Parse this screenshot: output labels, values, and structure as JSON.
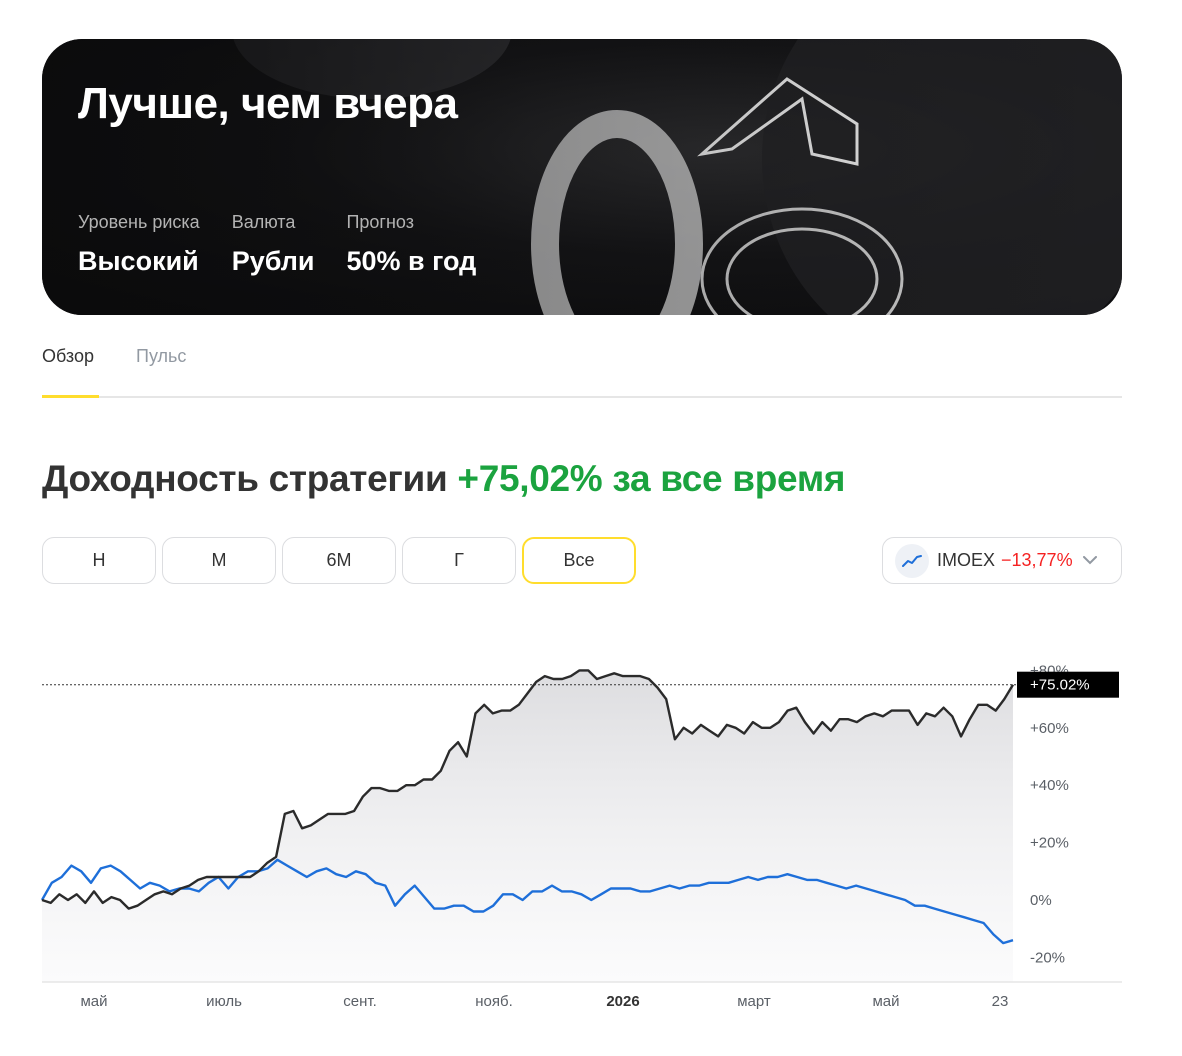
{
  "hero": {
    "title": "Лучше, чем вчера",
    "stats": [
      {
        "label": "Уровень риска",
        "value": "Высокий"
      },
      {
        "label": "Валюта",
        "value": "Рубли"
      },
      {
        "label": "Прогноз",
        "value": "50% в год"
      }
    ]
  },
  "tabs": [
    {
      "label": "Обзор",
      "active": true
    },
    {
      "label": "Пульс",
      "active": false
    }
  ],
  "headline": {
    "prefix": "Доходность стратегии",
    "value": "+75,02% за все время"
  },
  "periods": [
    {
      "label": "Н",
      "active": false
    },
    {
      "label": "М",
      "active": false
    },
    {
      "label": "6М",
      "active": false
    },
    {
      "label": "Г",
      "active": false
    },
    {
      "label": "Все",
      "active": true
    }
  ],
  "benchmark": {
    "name": "IMOEX",
    "value": "−13,77%",
    "icon": "trend-line-icon"
  },
  "colors": {
    "accent": "#ffdd2d",
    "positive": "#1ba33f",
    "negative": "#f52222",
    "strategy_line": "#2b2b2b",
    "benchmark_line": "#1e6fd9"
  },
  "chart_data": {
    "type": "line",
    "x_tick_labels": [
      "май",
      "июль",
      "сент.",
      "нояб.",
      "2026",
      "март",
      "май",
      "23"
    ],
    "y_tick_labels": [
      "+80%",
      "+60%",
      "+40%",
      "+20%",
      "0%",
      "-20%"
    ],
    "ylim": [
      -25,
      82
    ],
    "current_label": "+75.02%",
    "current_value": 75.02,
    "series": [
      {
        "role": "strategy",
        "values": [
          0,
          -1,
          2,
          0,
          2,
          -1,
          3,
          -1,
          1,
          0,
          -3,
          -2,
          0,
          2,
          3,
          2,
          4,
          5,
          7,
          8,
          8,
          8,
          8,
          8,
          8,
          10,
          13,
          15,
          30,
          31,
          25,
          26,
          28,
          30,
          30,
          30,
          31,
          36,
          39,
          39,
          38,
          38,
          40,
          40,
          42,
          42,
          45,
          52,
          55,
          50,
          65,
          68,
          65,
          66,
          66,
          68,
          72,
          76,
          78,
          77,
          77,
          78,
          80,
          80,
          77,
          78,
          79,
          78,
          78,
          78,
          77,
          74,
          70,
          56,
          60,
          58,
          61,
          59,
          57,
          61,
          60,
          58,
          62,
          60,
          60,
          62,
          66,
          67,
          62,
          58,
          62,
          59,
          63,
          63,
          62,
          64,
          65,
          64,
          66,
          66,
          66,
          61,
          65,
          64,
          67,
          64,
          57,
          63,
          68,
          68,
          66,
          70,
          75
        ]
      },
      {
        "role": "benchmark",
        "values": [
          0,
          6,
          8,
          12,
          10,
          6,
          11,
          12,
          10,
          7,
          4,
          6,
          5,
          3,
          4,
          4,
          3,
          6,
          8,
          4,
          8,
          10,
          10,
          11,
          14,
          12,
          10,
          8,
          10,
          11,
          9,
          8,
          10,
          9,
          6,
          5,
          -2,
          2,
          5,
          1,
          -3,
          -3,
          -2,
          -2,
          -4,
          -4,
          -2,
          2,
          2,
          0,
          3,
          3,
          5,
          3,
          3,
          2,
          0,
          2,
          4,
          4,
          4,
          3,
          3,
          4,
          5,
          4,
          5,
          5,
          6,
          6,
          6,
          7,
          8,
          7,
          8,
          8,
          9,
          8,
          7,
          7,
          6,
          5,
          4,
          5,
          4,
          3,
          2,
          1,
          0,
          -2,
          -2,
          -3,
          -4,
          -5,
          -6,
          -7,
          -8,
          -12,
          -15,
          -14
        ]
      }
    ]
  }
}
